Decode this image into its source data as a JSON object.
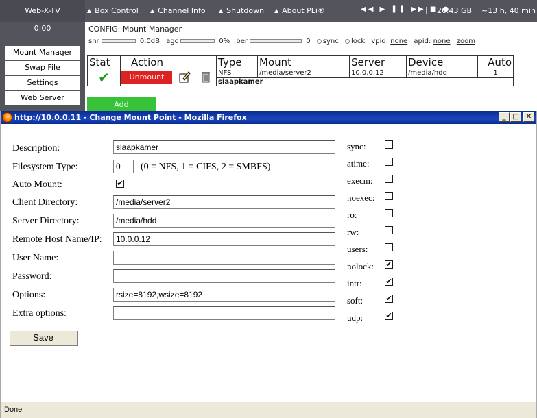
{
  "header": {
    "logo": "Web-X-TV",
    "menu": [
      "Box Control",
      "Channel Info",
      "Shutdown",
      "About PLi®"
    ],
    "player_glyphs": "◀◀ ▶ ❚❚ ▶▶ ■ ●",
    "separator": "|",
    "disk_space": "26.43 GB",
    "remaining": "~13 h, 40 min"
  },
  "sidebar": {
    "clock": "0:00",
    "items": [
      "Mount Manager",
      "Swap File",
      "Settings",
      "Web Server"
    ]
  },
  "main": {
    "config_title": "CONFIG: Mount Manager",
    "status": {
      "snr_label": "snr",
      "snr_value": "0.0dB",
      "agc_label": "agc",
      "agc_value": "0%",
      "ber_label": "ber",
      "ber_value": "0",
      "sync_label": "sync",
      "lock_label": "lock",
      "vpid_label": "vpid:",
      "vpid_value": "none",
      "apid_label": "apid:",
      "apid_value": "none",
      "zoom_label": "zoom"
    },
    "table": {
      "headers": [
        "Stat",
        "Action",
        "",
        "",
        "Type",
        "Mount",
        "Server",
        "Device",
        "Auto"
      ],
      "row": {
        "status_icon": "✔",
        "action_label": "Unmount",
        "type": "NFS",
        "mount": "/media/server2",
        "server": "10.0.0.12",
        "device": "/media/hdd",
        "auto": "1",
        "description": "slaapkamer"
      }
    },
    "add_label": "Add",
    "colors": {
      "unmount": "#d22222",
      "add": "#37c237",
      "check": "#1a9a1a"
    }
  },
  "popup": {
    "window_title": "http://10.0.0.11 - Change Mount Point - Mozilla Firefox",
    "controls": {
      "minimize": "_",
      "maximize": "□",
      "close": "✕"
    },
    "form": {
      "description_label": "Description:",
      "description_value": "slaapkamer",
      "fstype_label": "Filesystem Type:",
      "fstype_value": "0",
      "fstype_hint": "(0 = NFS, 1 = CIFS, 2 = SMBFS)",
      "automount_label": "Auto Mount:",
      "automount_checked": "✔",
      "client_dir_label": "Client Directory:",
      "client_dir_value": "/media/server2",
      "server_dir_label": "Server Directory:",
      "server_dir_value": "/media/hdd",
      "remote_host_label": "Remote Host Name/IP:",
      "remote_host_value": "10.0.0.12",
      "username_label": "User Name:",
      "username_value": "",
      "password_label": "Password:",
      "password_value": "",
      "options_label": "Options:",
      "options_value": "rsize=8192,wsize=8192",
      "extra_options_label": "Extra options:",
      "extra_options_value": "",
      "save_label": "Save"
    },
    "mount_options": [
      {
        "label": "sync:",
        "mark": ""
      },
      {
        "label": "atime:",
        "mark": ""
      },
      {
        "label": "execm:",
        "mark": ""
      },
      {
        "label": "noexec:",
        "mark": ""
      },
      {
        "label": "ro:",
        "mark": ""
      },
      {
        "label": "rw:",
        "mark": ""
      },
      {
        "label": "users:",
        "mark": ""
      },
      {
        "label": "nolock:",
        "mark": "✔"
      },
      {
        "label": "intr:",
        "mark": "✔"
      },
      {
        "label": "soft:",
        "mark": "✔"
      },
      {
        "label": "udp:",
        "mark": "✔"
      }
    ],
    "status": "Done"
  }
}
